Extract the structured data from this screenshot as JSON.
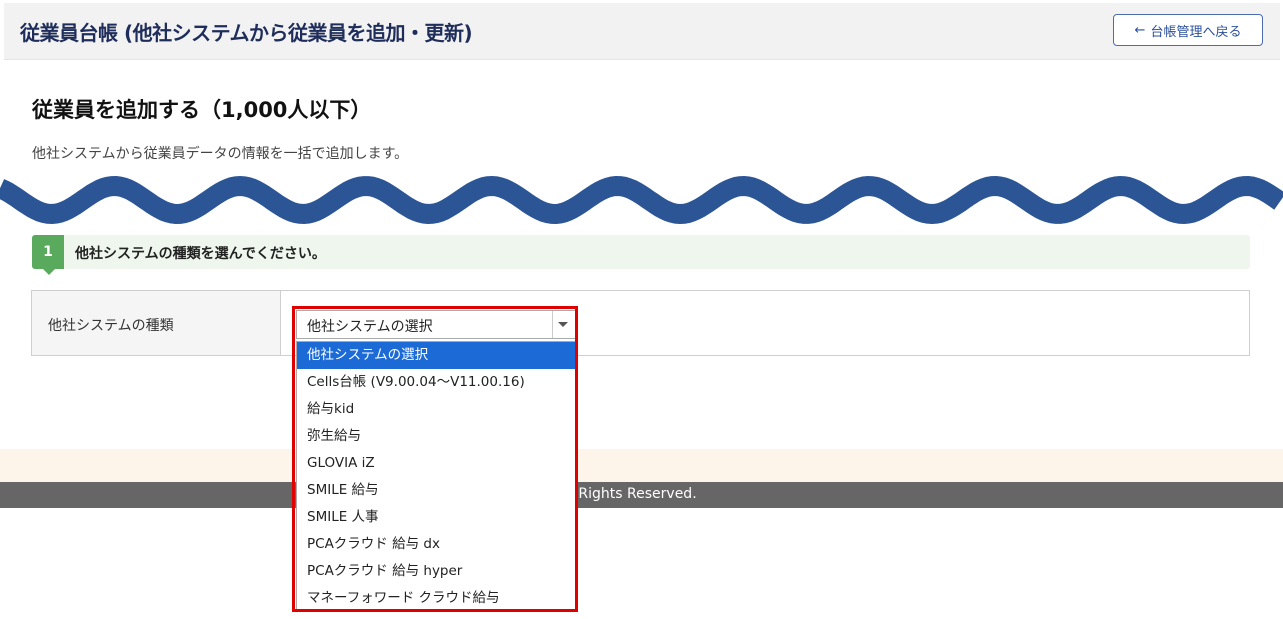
{
  "header": {
    "title": "従業員台帳 (他社システムから従業員を追加・更新)",
    "back_icon": "←",
    "back_label": "台帳管理へ戻る"
  },
  "section": {
    "title": "従業員を追加する（1,000人以下）",
    "description": "他社システムから従業員データの情報を一括で追加します。"
  },
  "step": {
    "number": "1",
    "text": "他社システムの種類を選んでください。"
  },
  "form": {
    "label": "他社システムの種類",
    "selected_value": "他社システムの選択"
  },
  "dropdown": {
    "options": [
      "他社システムの選択",
      "Cells台帳 (V9.00.04〜V11.00.16)",
      "給与kid",
      "弥生給与",
      "GLOVIA iZ",
      "SMILE 給与",
      "SMILE 人事",
      "PCAクラウド 給与 dx",
      "PCAクラウド 給与 hyper",
      "マネーフォワード クラウド給与"
    ],
    "selected_index": 0
  },
  "footer": {
    "copyright": "M co.,ltd. All Rights Reserved."
  },
  "colors": {
    "accent_blue": "#1c6ad6",
    "wave_blue": "#2c5596",
    "step_green": "#5aaa5e",
    "highlight_red": "#e00000"
  }
}
